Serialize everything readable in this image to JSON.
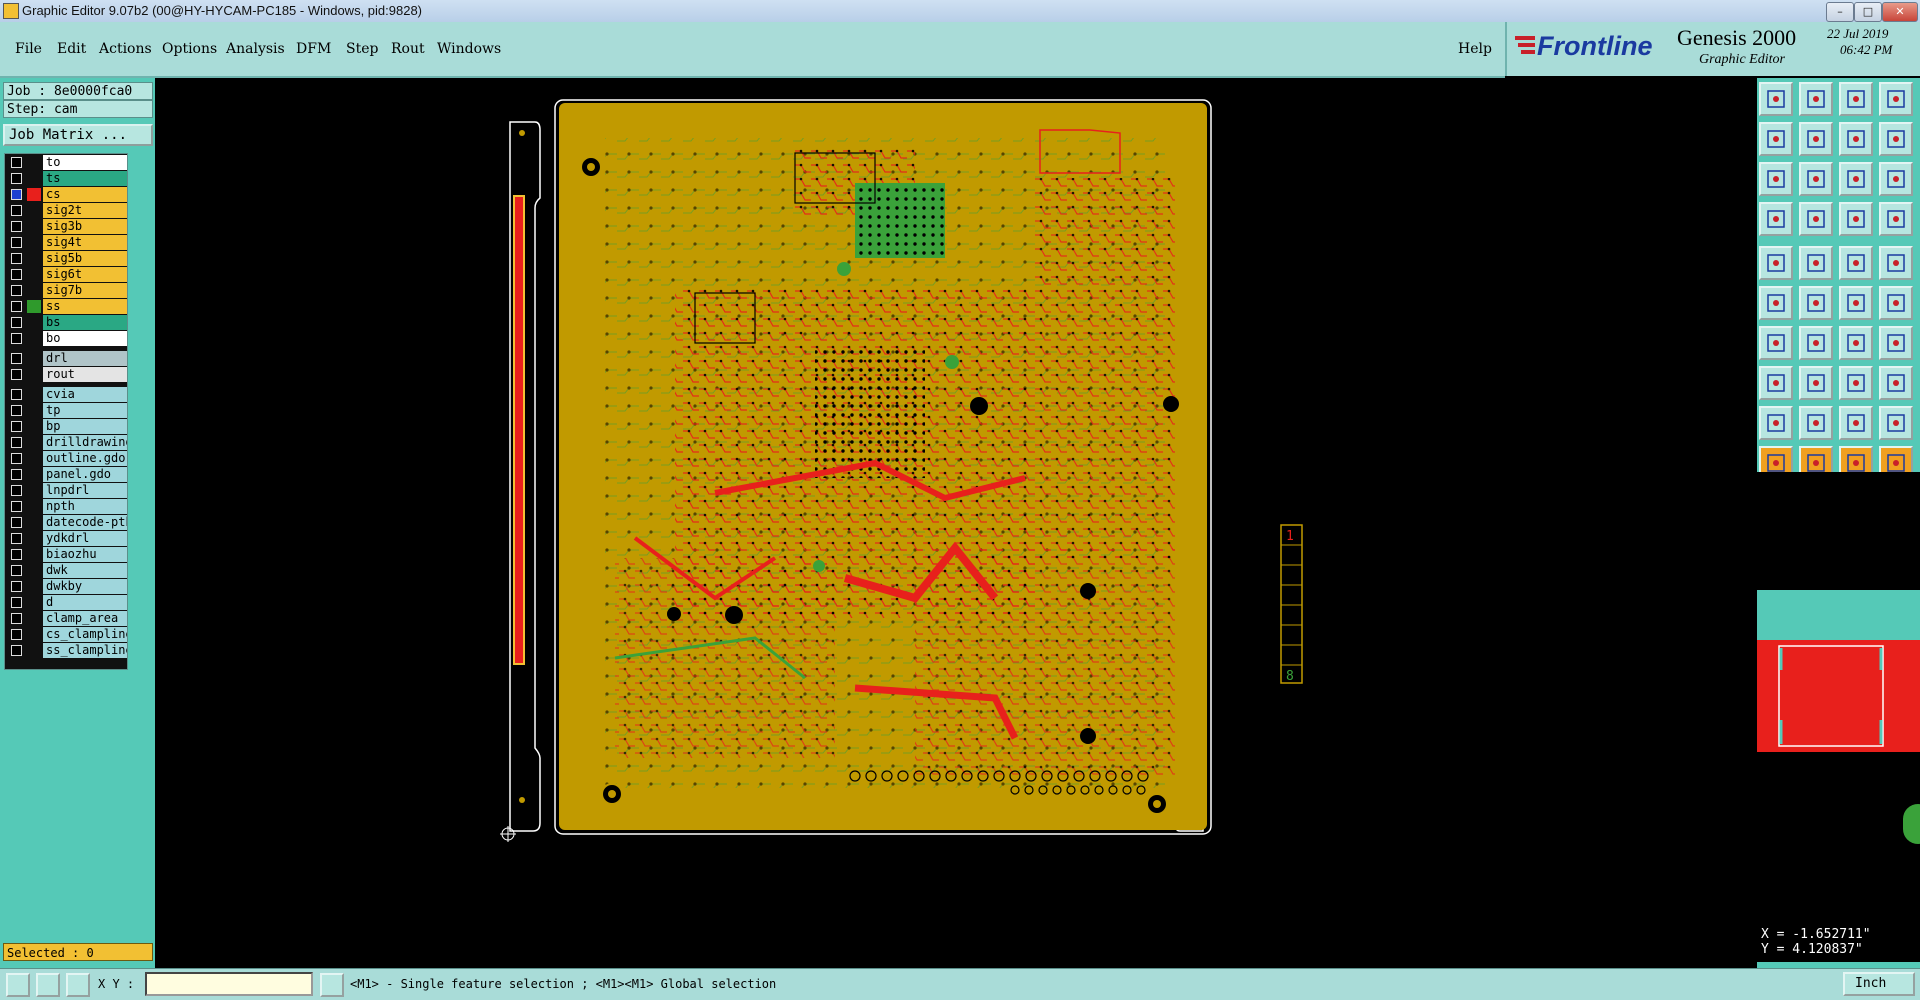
{
  "window": {
    "title": "Graphic Editor 9.07b2 (00@HY-HYCAM-PC185 - Windows, pid:9828)"
  },
  "menu": {
    "items": [
      "File",
      "Edit",
      "Actions",
      "Options",
      "Analysis",
      "DFM",
      "Step",
      "Rout",
      "Windows"
    ],
    "help": "Help"
  },
  "brand": {
    "logo": "Frontline",
    "product": "Genesis 2000",
    "subtitle": "Graphic Editor",
    "date": "22 Jul 2019",
    "time": "06:42 PM"
  },
  "job": {
    "job_label": "Job : 8e0000fca0",
    "step_label": "Step: cam",
    "matrix_button": "Job Matrix ..."
  },
  "layers": [
    {
      "name": "to",
      "bg": "#ffffff"
    },
    {
      "name": "ts",
      "bg": "#2aa884"
    },
    {
      "name": "cs",
      "bg": "#f2c033",
      "color": "#e8201c",
      "active": true
    },
    {
      "name": "sig2t",
      "bg": "#f2c033"
    },
    {
      "name": "sig3b",
      "bg": "#f2c033"
    },
    {
      "name": "sig4t",
      "bg": "#f2c033"
    },
    {
      "name": "sig5b",
      "bg": "#f2c033"
    },
    {
      "name": "sig6t",
      "bg": "#f2c033"
    },
    {
      "name": "sig7b",
      "bg": "#f2c033"
    },
    {
      "name": "ss",
      "bg": "#f2c033",
      "color": "#2f9a2c"
    },
    {
      "name": "bs",
      "bg": "#2aa884"
    },
    {
      "name": "bo",
      "bg": "#ffffff"
    },
    {
      "name": "drl",
      "bg": "#b0c4c8"
    },
    {
      "name": "rout",
      "bg": "#e4e4e4"
    },
    {
      "name": "cvia",
      "bg": "#9fd6dc"
    },
    {
      "name": "tp",
      "bg": "#9fd6dc"
    },
    {
      "name": "bp",
      "bg": "#9fd6dc"
    },
    {
      "name": "drilldrawing",
      "bg": "#9fd6dc"
    },
    {
      "name": "outline.gdo",
      "bg": "#9fd6dc"
    },
    {
      "name": "panel.gdo",
      "bg": "#9fd6dc"
    },
    {
      "name": "lnpdrl",
      "bg": "#9fd6dc"
    },
    {
      "name": "npth",
      "bg": "#9fd6dc"
    },
    {
      "name": "datecode-pth",
      "bg": "#9fd6dc"
    },
    {
      "name": "ydkdrl",
      "bg": "#9fd6dc"
    },
    {
      "name": "biaozhu",
      "bg": "#9fd6dc"
    },
    {
      "name": "dwk",
      "bg": "#9fd6dc"
    },
    {
      "name": "dwkby",
      "bg": "#9fd6dc"
    },
    {
      "name": "d",
      "bg": "#9fd6dc"
    },
    {
      "name": "clamp_area",
      "bg": "#9fd6dc"
    },
    {
      "name": "cs_clampline",
      "bg": "#9fd6dc"
    },
    {
      "name": "ss_clampline",
      "bg": "#9fd6dc"
    }
  ],
  "selection": {
    "label": "Selected : 0"
  },
  "board": {
    "edge_mark_top": "1",
    "edge_mark_bottom": "8"
  },
  "coords": {
    "x": "X = -1.652711\"",
    "y": "Y = 4.120837\""
  },
  "status": {
    "xy_label": "X Y :",
    "xy_value": "",
    "message": "<M1> - Single feature selection ; <M1><M1> Global selection",
    "units": "Inch"
  },
  "colors": {
    "board": "#c19a00",
    "copper_red": "#e8201c",
    "copper_green": "#3aa23a",
    "panel": "#55c9b7",
    "menu": "#a9dcd8"
  },
  "toolbar_icons": [
    "zoom-home-icon",
    "zoom-page-icon",
    "home-icon",
    "window-split-icon",
    "pan-left-icon",
    "pan-right-icon",
    "fit-icon",
    "snap-icon",
    "zoom-fit-icon",
    "zoom-center-icon",
    "ratio-icon",
    "query-icon",
    "measure-icon",
    "grid-icon",
    "layer-stack-icon",
    "layer-stack-alt-icon",
    "add-pad-icon",
    "add-line-icon",
    "ruler-icon",
    "pad-icon",
    "connect-icon",
    "cross-icon",
    "move-icon",
    "move-alt-icon",
    "line-icon",
    "line-alt-icon",
    "arc-icon",
    "polygon-icon",
    "feature-icon",
    "minus-icon",
    "resize-icon",
    "group-icon",
    "triangle-icon",
    "triangle-alt-icon",
    "triangle-edit-icon",
    "triangle-bold-icon",
    "select-pointer-icon",
    "select-pointer-alt-icon",
    "select-pointer-edit-icon",
    "select-pointer-net-icon"
  ]
}
